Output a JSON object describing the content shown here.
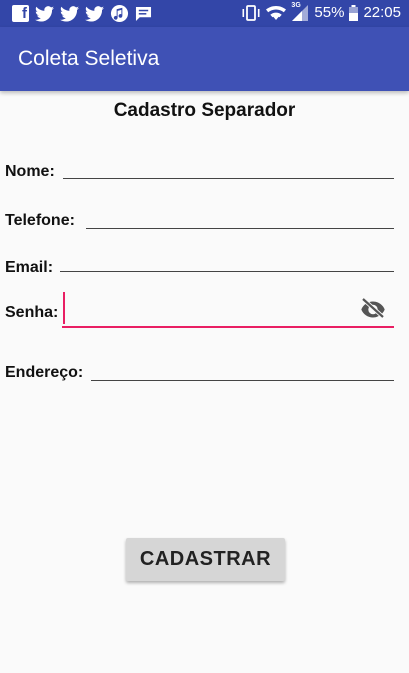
{
  "status_bar": {
    "icons_left": [
      "facebook-icon",
      "twitter-icon",
      "twitter-icon",
      "twitter-icon",
      "music-icon",
      "message-icon"
    ],
    "icons_right": [
      "vibrate-icon",
      "wifi-icon",
      "signal-icon",
      "battery-icon"
    ],
    "network_label": "3G",
    "battery_percent": "55%",
    "time": "22:05"
  },
  "app_bar": {
    "title": "Coleta Seletiva"
  },
  "form": {
    "title": "Cadastro Separador",
    "nome_label": "Nome:",
    "telefone_label": "Telefone:",
    "email_label": "Email:",
    "senha_label": "Senha:",
    "endereco_label": "Endereço:",
    "submit_label": "CADASTRAR"
  },
  "colors": {
    "status_bar": "#3346a8",
    "app_bar": "#3f51b5",
    "accent": "#e91e63",
    "button_bg": "#d6d6d6"
  }
}
